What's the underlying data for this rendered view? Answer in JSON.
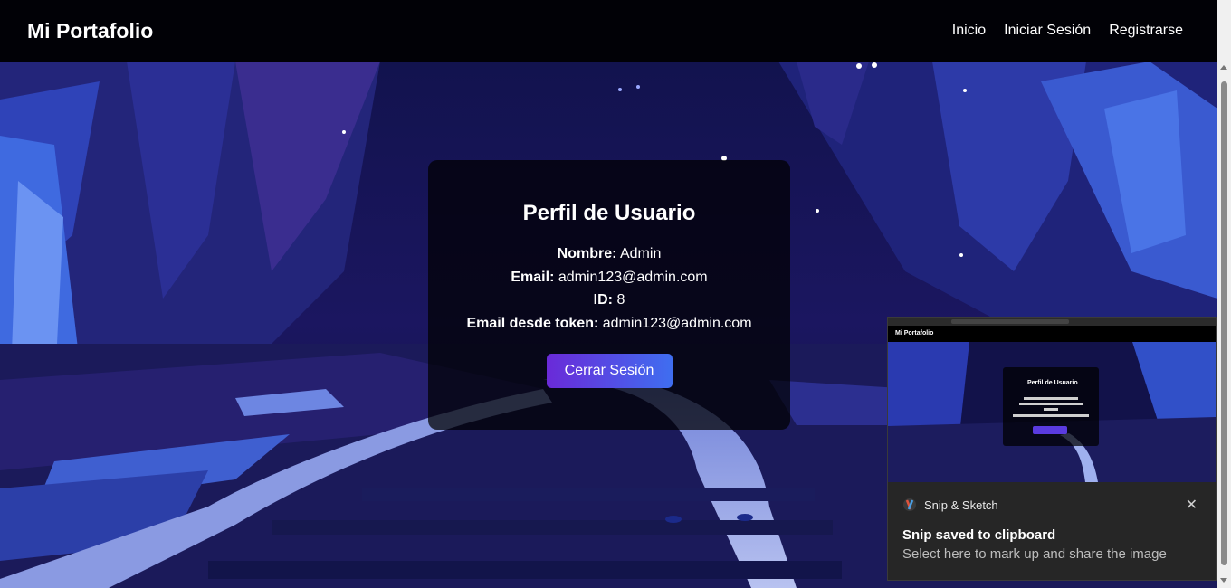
{
  "navbar": {
    "brand": "Mi Portafolio",
    "links": [
      "Inicio",
      "Iniciar Sesión",
      "Registrarse"
    ]
  },
  "profile": {
    "title": "Perfil de Usuario",
    "name_label": "Nombre:",
    "name_value": "Admin",
    "email_label": "Email:",
    "email_value": "admin123@admin.com",
    "id_label": "ID:",
    "id_value": "8",
    "token_email_label": "Email desde token:",
    "token_email_value": "admin123@admin.com",
    "logout_label": "Cerrar Sesión"
  },
  "notification": {
    "app_name": "Snip & Sketch",
    "title": "Snip saved to clipboard",
    "subtitle": "Select here to mark up and share the image",
    "close_icon": "close-icon"
  },
  "thumbnail": {
    "brand": "Mi Portafolio",
    "title": "Perfil de Usuario"
  },
  "colors": {
    "navbar": "#000000",
    "button_start": "#6a2ad8",
    "button_end": "#3f6ef0",
    "toast_bg": "#262626"
  }
}
